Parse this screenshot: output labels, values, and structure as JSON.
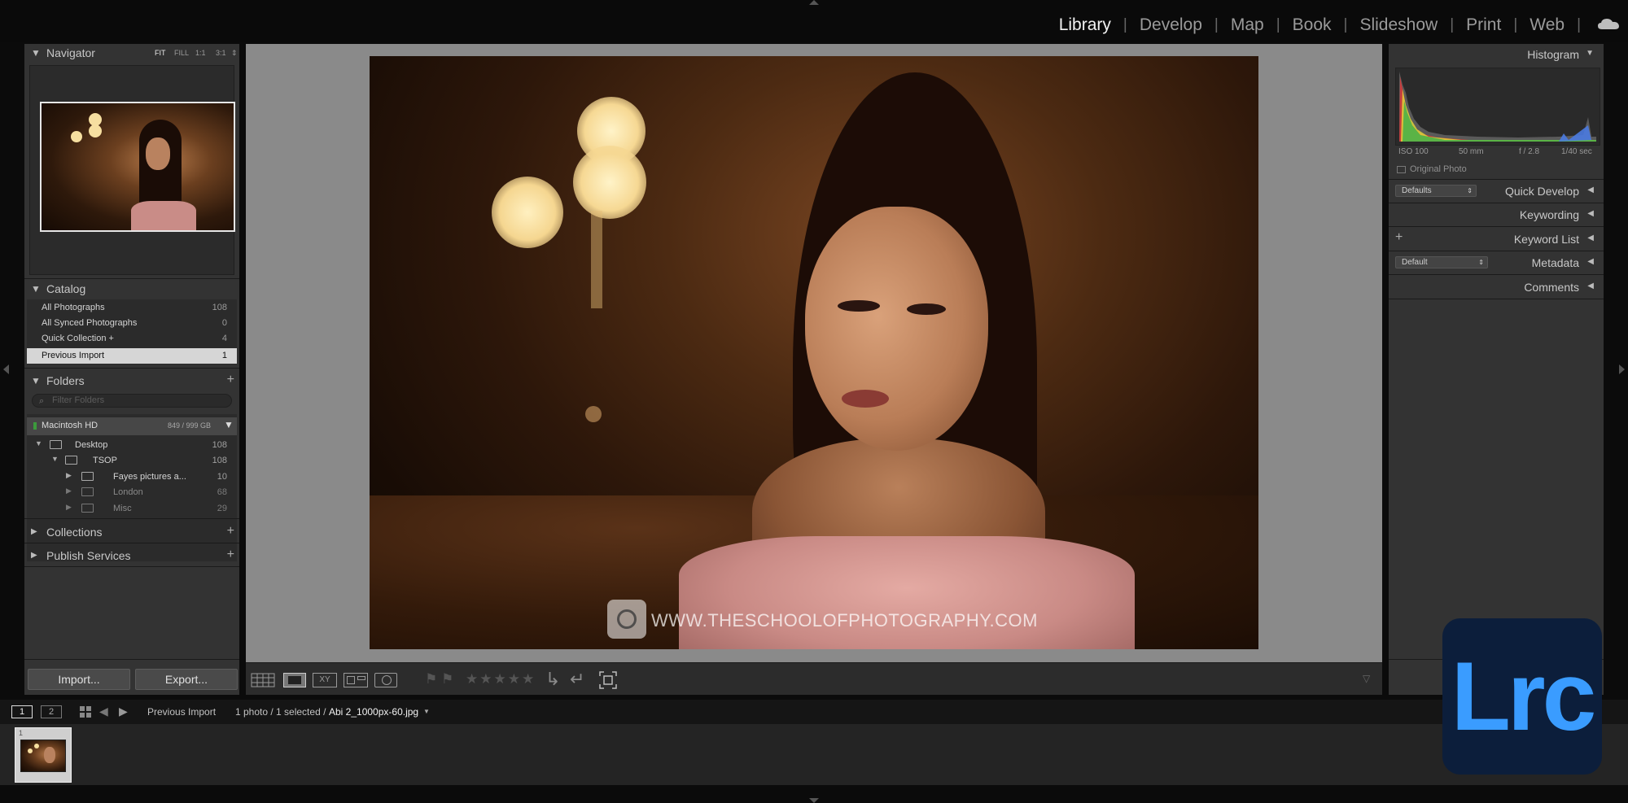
{
  "modules": [
    "Library",
    "Develop",
    "Map",
    "Book",
    "Slideshow",
    "Print",
    "Web"
  ],
  "active_module": "Library",
  "left_panel": {
    "navigator": {
      "title": "Navigator",
      "zoom": [
        "FIT",
        "FILL",
        "1:1",
        "3:1"
      ]
    },
    "catalog": {
      "title": "Catalog",
      "items": [
        {
          "label": "All Photographs",
          "count": "108"
        },
        {
          "label": "All Synced Photographs",
          "count": "0"
        },
        {
          "label": "Quick Collection +",
          "count": "4"
        },
        {
          "label": "Previous Import",
          "count": "1"
        }
      ]
    },
    "folders": {
      "title": "Folders",
      "filter_placeholder": "Filter Folders",
      "volume": {
        "name": "Macintosh HD",
        "space": "849 / 999 GB"
      },
      "tree": [
        {
          "label": "Desktop",
          "count": "108"
        },
        {
          "label": "TSOP",
          "count": "108"
        },
        {
          "label": "Fayes pictures a...",
          "count": "10"
        },
        {
          "label": "London",
          "count": "68"
        },
        {
          "label": "Misc",
          "count": "29"
        }
      ]
    },
    "collections": {
      "title": "Collections"
    },
    "publish": {
      "title": "Publish Services"
    },
    "import_label": "Import...",
    "export_label": "Export..."
  },
  "right_panel": {
    "histogram": {
      "title": "Histogram",
      "iso": "ISO 100",
      "focal": "50 mm",
      "aperture": "f / 2.8",
      "shutter": "1/40 sec",
      "original_photo": "Original Photo"
    },
    "quick_develop": {
      "title": "Quick Develop",
      "preset": "Defaults"
    },
    "keywording": {
      "title": "Keywording"
    },
    "keyword_list": {
      "title": "Keyword List"
    },
    "metadata": {
      "title": "Metadata",
      "preset": "Default"
    },
    "comments": {
      "title": "Comments"
    }
  },
  "photo": {
    "watermark": "WWW.THESCHOOLOFPHOTOGRAPHY.COM"
  },
  "filmstrip": {
    "page1": "1",
    "page2": "2",
    "source": "Previous Import",
    "count_text": "1 photo / 1 selected /",
    "filename": "Abi 2_1000px-60.jpg",
    "cell_index": "1"
  },
  "badge": "Lrc",
  "colors": {
    "badge_bg": "#0c1e3b",
    "badge_text": "#3a9cff",
    "panel_bg": "#333333",
    "center_bg": "#8a8a8a"
  }
}
